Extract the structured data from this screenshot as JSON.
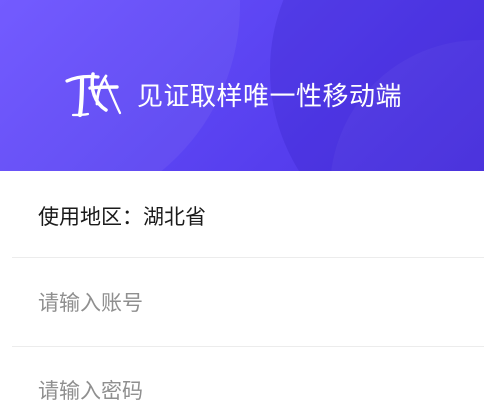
{
  "header": {
    "title": "见证取样唯一性移动端",
    "logo": {
      "mark": "ZK",
      "subtext": ""
    },
    "colors": {
      "gradient_start": "#6b52ff",
      "gradient_end": "#4d33e6",
      "title_text": "#ffffff"
    }
  },
  "form": {
    "region": {
      "label": "使用地区：",
      "value": "湖北省"
    },
    "account": {
      "value": "",
      "placeholder": "请输入账号"
    },
    "password": {
      "value": "",
      "placeholder": "请输入密码"
    },
    "colors": {
      "label_text": "#1b1b1b",
      "placeholder_text": "#8f8f8f",
      "divider": "#ececec"
    }
  }
}
